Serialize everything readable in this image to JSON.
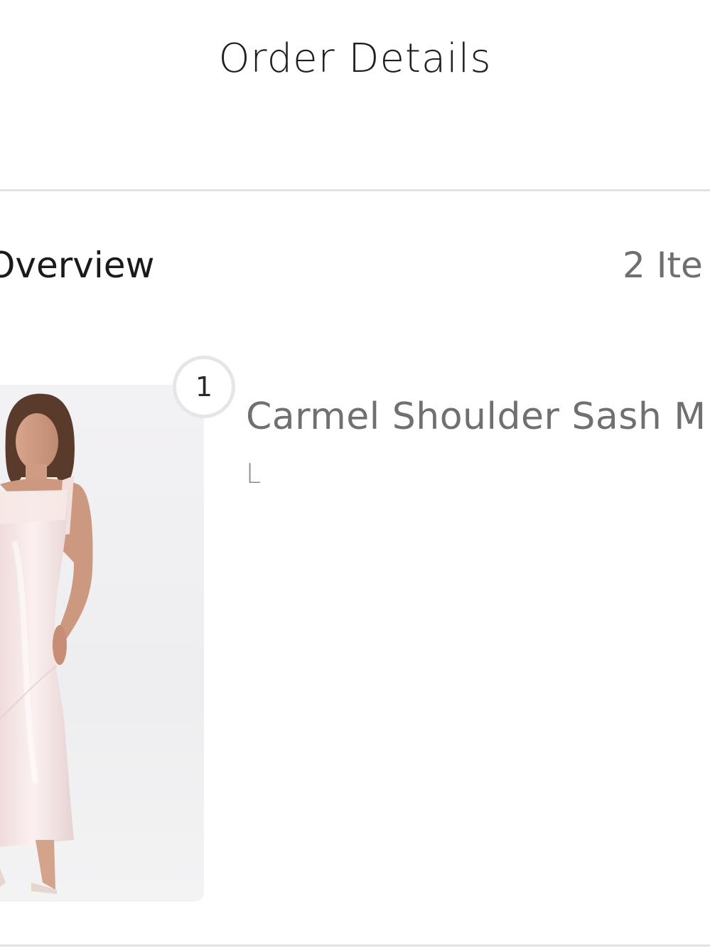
{
  "header": {
    "title": "Order Details"
  },
  "overview": {
    "title": "Overview",
    "item_count": "2 Ite"
  },
  "items": [
    {
      "quantity": "1",
      "name": "Carmel Shoulder Sash M",
      "size": "L",
      "image_description_icon": "product-photo"
    }
  ],
  "colors": {
    "dress": "#f3e4e3",
    "background": "#ffffff",
    "divider": "#e3e3e3",
    "muted_text": "#707070"
  }
}
